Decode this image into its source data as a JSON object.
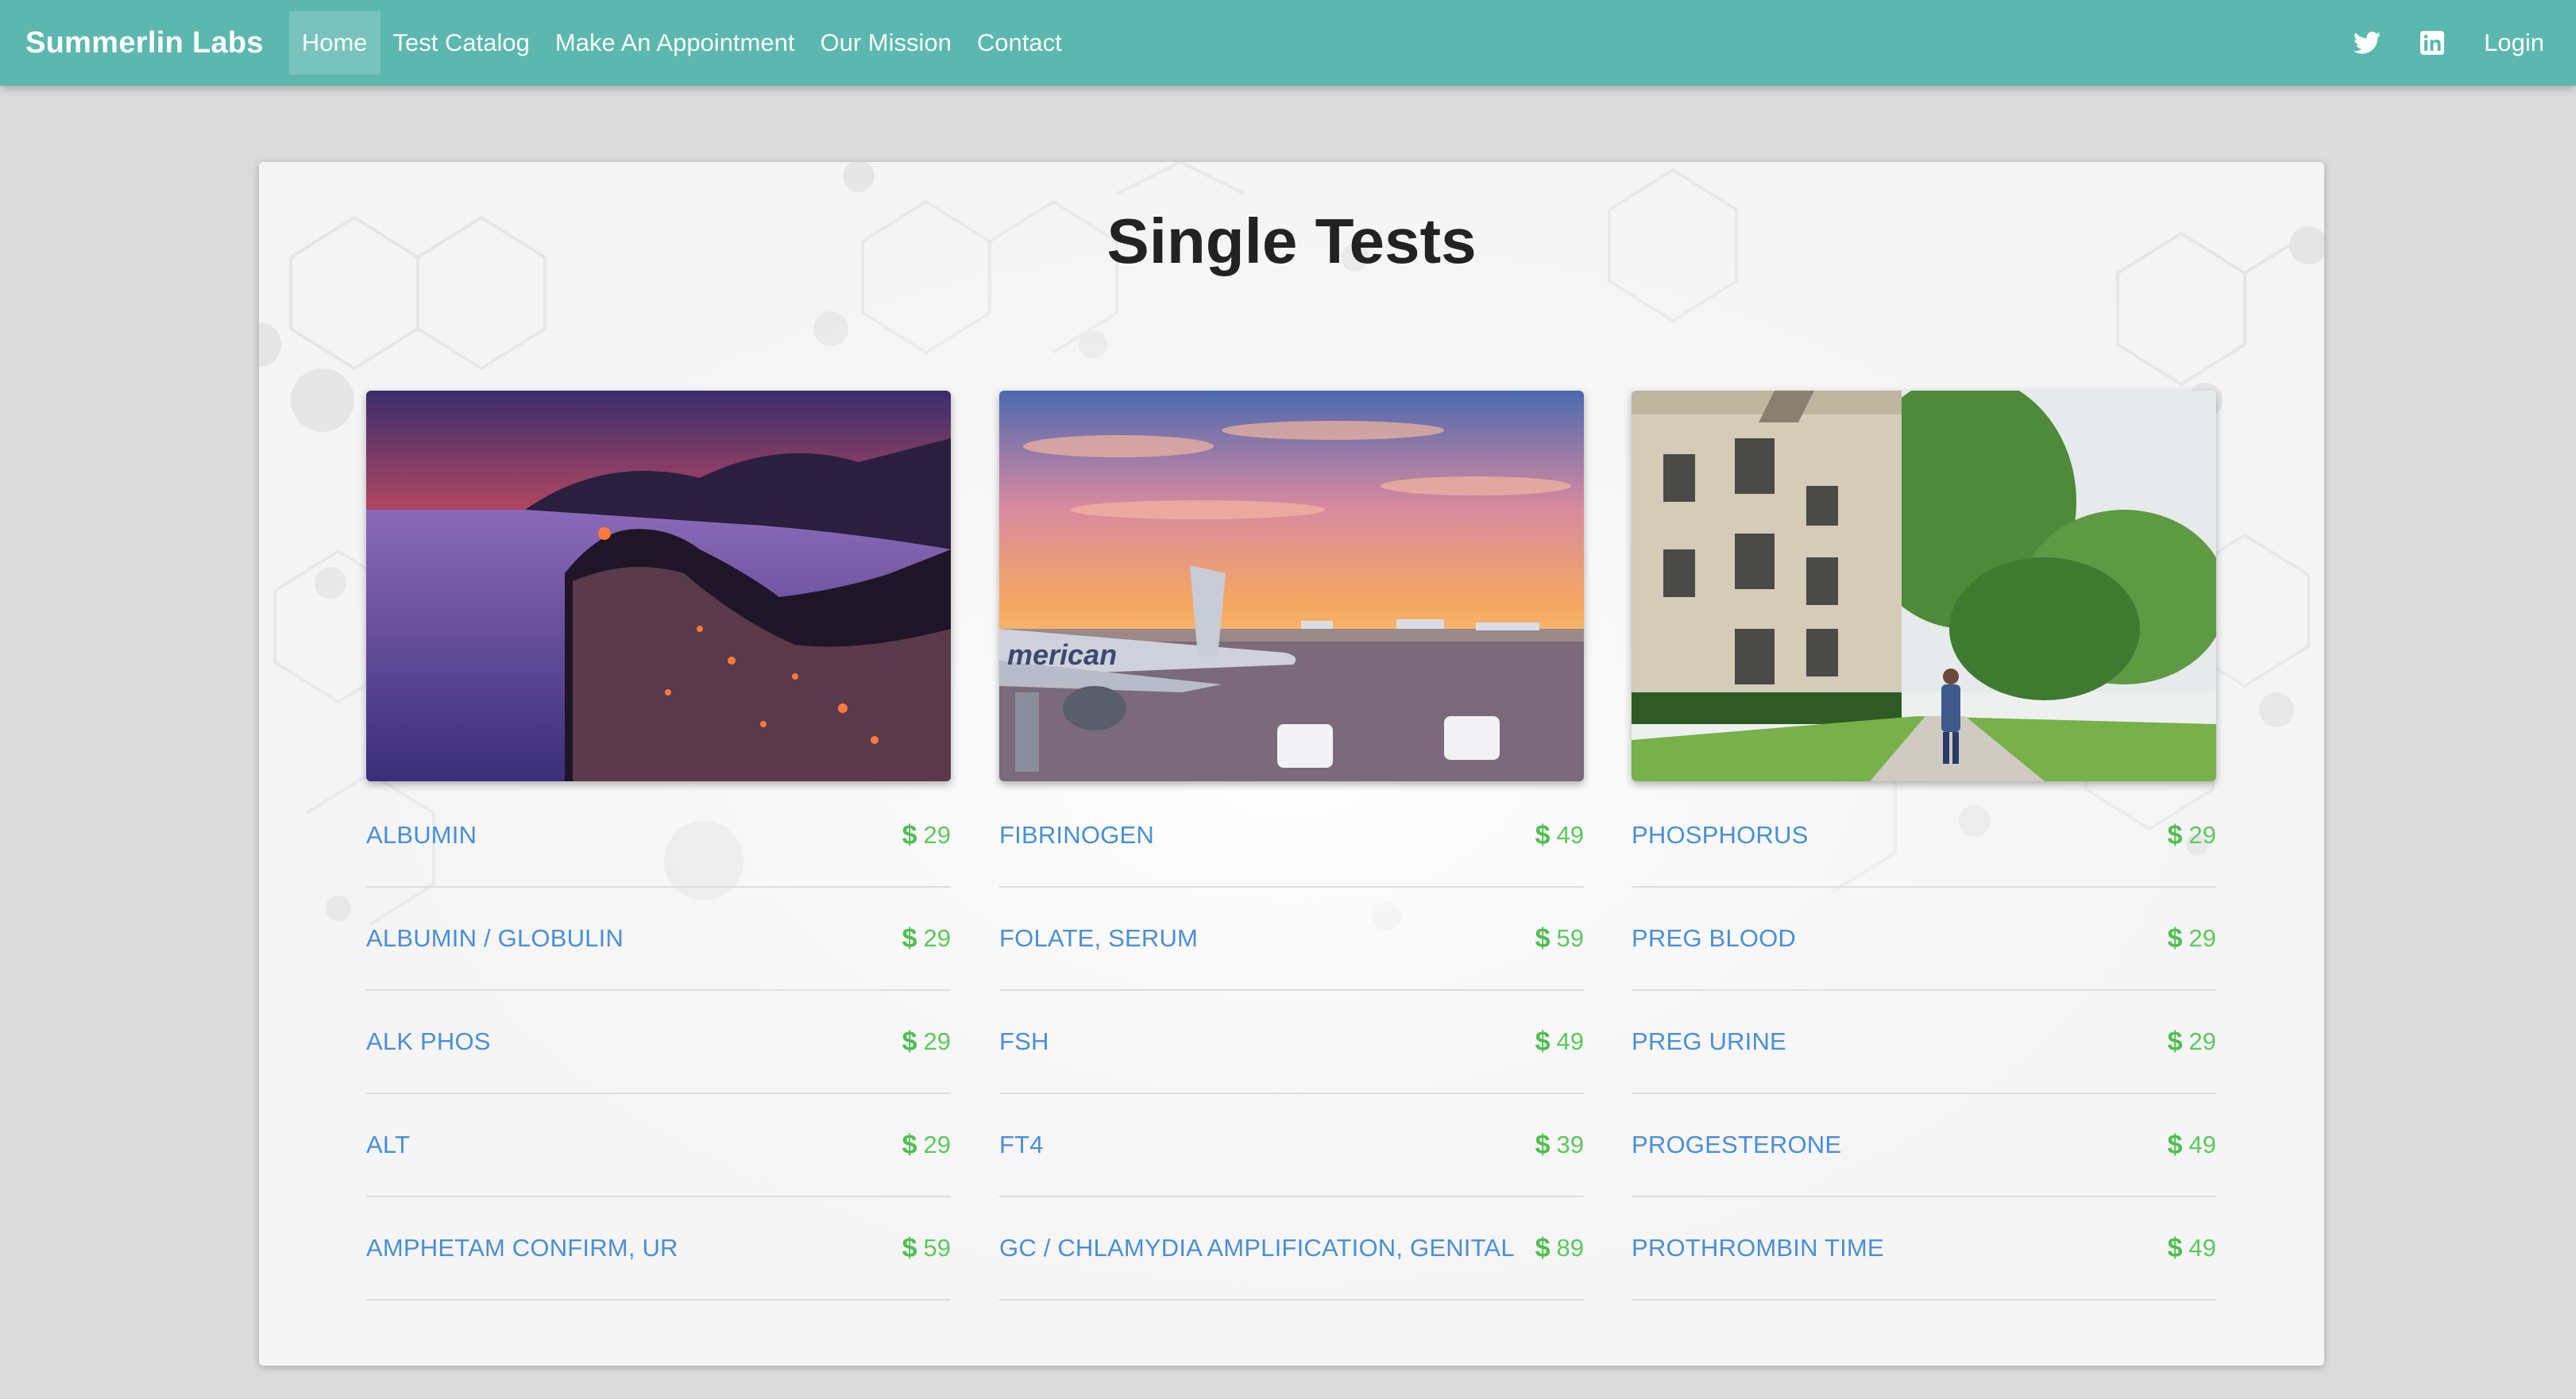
{
  "navbar": {
    "brand": "Summerlin Labs",
    "links": [
      "Home",
      "Test Catalog",
      "Make An Appointment",
      "Our Mission",
      "Contact"
    ],
    "active": "Home",
    "icons": [
      "twitter-icon",
      "linkedin-icon"
    ],
    "login": "Login",
    "color": "#5cb8ae"
  },
  "page": {
    "title": "Single Tests"
  },
  "columns": [
    {
      "image": "coastal-village-sunset",
      "tests": [
        {
          "name": "ALBUMIN",
          "currency": "$",
          "price": "29"
        },
        {
          "name": "ALBUMIN / GLOBULIN",
          "currency": "$",
          "price": "29"
        },
        {
          "name": "ALK PHOS",
          "currency": "$",
          "price": "29"
        },
        {
          "name": "ALT",
          "currency": "$",
          "price": "29"
        },
        {
          "name": "AMPHETAM CONFIRM, UR",
          "currency": "$",
          "price": "59"
        }
      ]
    },
    {
      "image": "airport-tarmac-sunset",
      "tests": [
        {
          "name": "FIBRINOGEN",
          "currency": "$",
          "price": "49"
        },
        {
          "name": "FOLATE, SERUM",
          "currency": "$",
          "price": "59"
        },
        {
          "name": "FSH",
          "currency": "$",
          "price": "49"
        },
        {
          "name": "FT4",
          "currency": "$",
          "price": "39"
        },
        {
          "name": "GC / CHLAMYDIA AMPLIFICATION, GENITAL",
          "currency": "$",
          "price": "89"
        }
      ]
    },
    {
      "image": "college-garden-path",
      "tests": [
        {
          "name": "PHOSPHORUS",
          "currency": "$",
          "price": "29"
        },
        {
          "name": "PREG BLOOD",
          "currency": "$",
          "price": "29"
        },
        {
          "name": "PREG URINE",
          "currency": "$",
          "price": "29"
        },
        {
          "name": "PROGESTERONE",
          "currency": "$",
          "price": "49"
        },
        {
          "name": "PROTHROMBIN TIME",
          "currency": "$",
          "price": "49"
        }
      ]
    }
  ],
  "colors": {
    "link": "#4a8fd6",
    "price": "#5cc95c"
  }
}
